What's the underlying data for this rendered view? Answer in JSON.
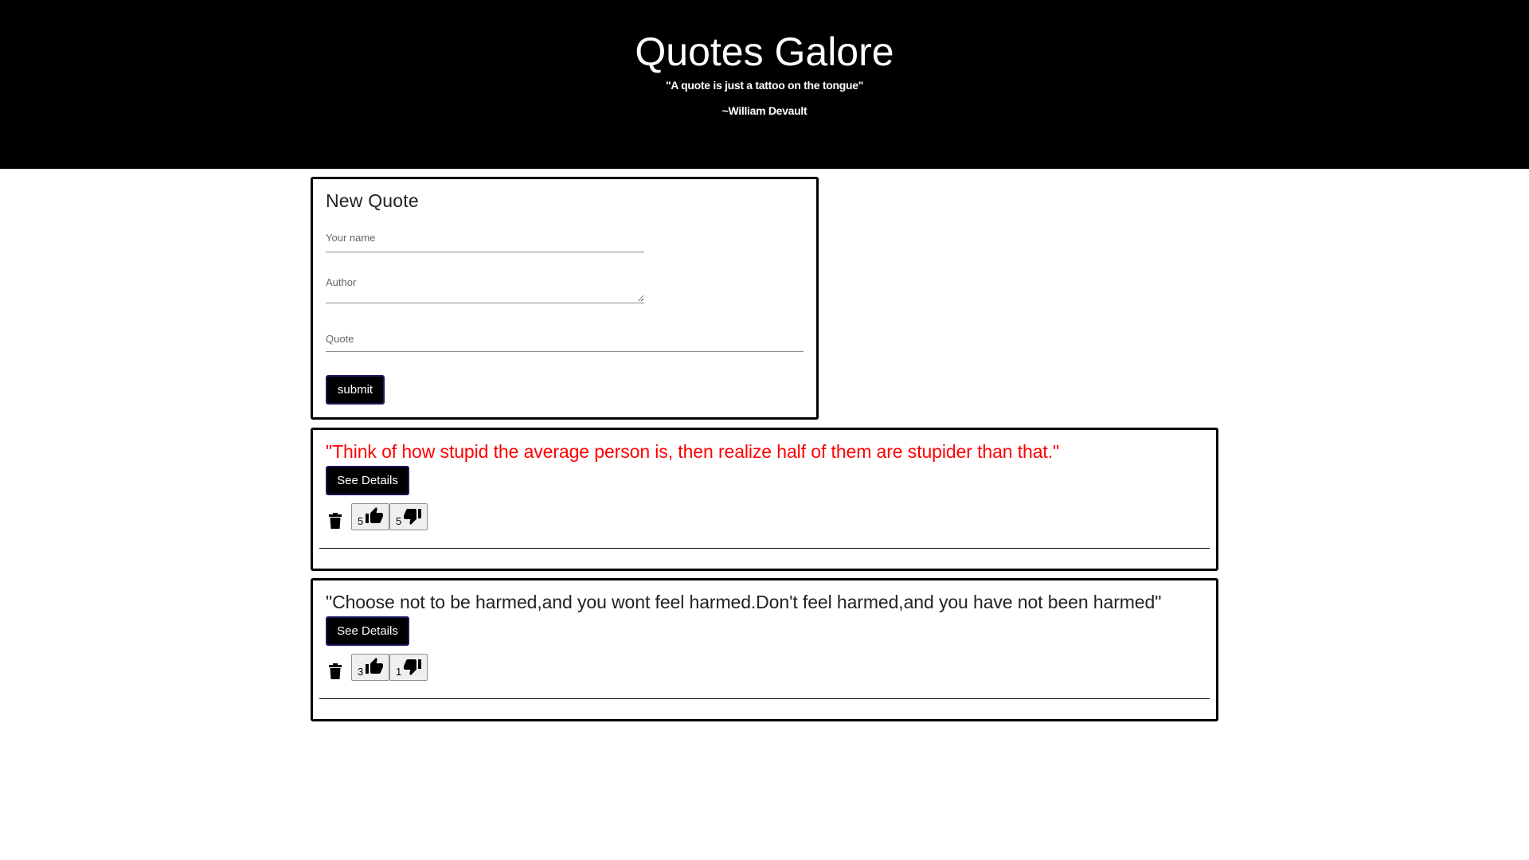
{
  "header": {
    "title": "Quotes Galore",
    "tagline": "\"A quote is just a tattoo on the tongue\"",
    "tagline_author": "~William Devault"
  },
  "form": {
    "title": "New Quote",
    "name_label": "Your name",
    "author_label": "Author",
    "quote_label": "Quote",
    "submit_label": "submit"
  },
  "quotes": [
    {
      "text": "\"Think of how stupid the average person is, then realize half of them are stupider than that.\"",
      "color": "#ff0000",
      "details_label": "See Details",
      "likes": "5",
      "dislikes": "5"
    },
    {
      "text": "\"Choose not to be harmed,and you wont feel harmed.Don't feel harmed,and you have not been harmed\"",
      "color": "#222222",
      "details_label": "See Details",
      "likes": "3",
      "dislikes": "1"
    }
  ],
  "icons": {
    "delete": "trash-icon",
    "like": "thumbs-up-icon",
    "dislike": "thumbs-down-icon"
  }
}
